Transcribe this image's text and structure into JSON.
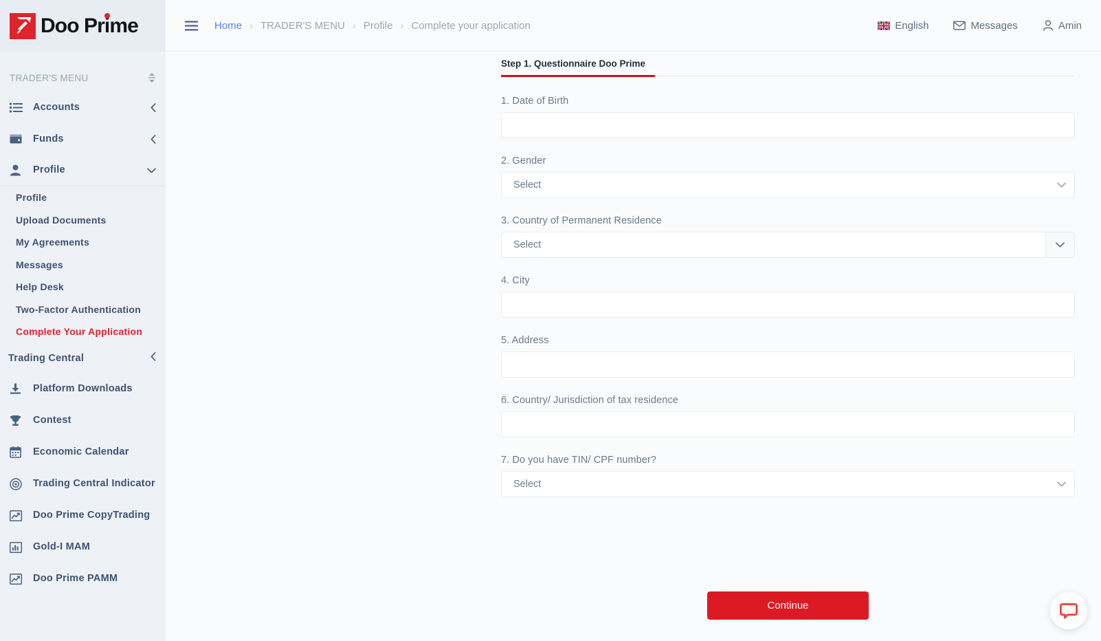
{
  "brand": {
    "name": "Doo Prime",
    "logo_icon": "doo-prime-logo",
    "primary_color": "#e0242b",
    "button_color": "#dc1a23",
    "tab_underline_color": "#c9141e"
  },
  "sidebar": {
    "section_title": "TRADER'S MENU",
    "sort_icon": "sort-updown-icon",
    "nav": [
      {
        "label": "Accounts",
        "icon": "list-icon",
        "chevron": "chevron-left-icon",
        "expanded": false
      },
      {
        "label": "Funds",
        "icon": "wallet-icon",
        "chevron": "chevron-left-icon",
        "expanded": false
      },
      {
        "label": "Profile",
        "icon": "user-icon",
        "chevron": "chevron-down-icon",
        "expanded": true
      }
    ],
    "profile_submenu": [
      {
        "label": "Profile",
        "active": false
      },
      {
        "label": "Upload Documents",
        "active": false
      },
      {
        "label": "My Agreements",
        "active": false
      },
      {
        "label": "Messages",
        "active": false
      },
      {
        "label": "Help Desk",
        "active": false
      },
      {
        "label": "Two-Factor Authentication",
        "active": false
      },
      {
        "label": "Complete Your Application",
        "active": true
      }
    ],
    "trading_central": {
      "label": "Trading Central",
      "chevron": "chevron-left-icon"
    },
    "tools": [
      {
        "label": "Platform Downloads",
        "icon": "download-icon"
      },
      {
        "label": "Contest",
        "icon": "trophy-icon"
      },
      {
        "label": "Economic Calendar",
        "icon": "calendar-icon"
      },
      {
        "label": "Trading Central Indicator",
        "icon": "target-icon"
      },
      {
        "label": "Doo Prime CopyTrading",
        "icon": "chart-line-up-icon"
      },
      {
        "label": "Gold-I MAM",
        "icon": "bar-chart-icon"
      },
      {
        "label": "Doo Prime PAMM",
        "icon": "chart-line-up-icon"
      }
    ]
  },
  "header": {
    "menu_toggle_icon": "hamburger-icon",
    "breadcrumb": [
      {
        "label": "Home",
        "link": true
      },
      {
        "label": "TRADER'S MENU",
        "link": false
      },
      {
        "label": "Profile",
        "link": false
      },
      {
        "label": "Complete your application",
        "link": false
      }
    ],
    "separator": "›",
    "language": {
      "label": "English",
      "icon": "uk-flag-icon"
    },
    "messages": {
      "label": "Messages",
      "icon": "envelope-icon"
    },
    "user": {
      "label": "Amin",
      "icon": "user-icon"
    }
  },
  "main": {
    "tabs": [
      {
        "label": "Step 1. Questionnaire Doo Prime",
        "active": true
      }
    ],
    "fields": [
      {
        "label": "1. Date of Birth",
        "type": "text",
        "value": "",
        "placeholder": ""
      },
      {
        "label": "2. Gender",
        "type": "select",
        "value": "Select",
        "chevron": "chevron-down-icon"
      },
      {
        "label": "3. Country of Permanent Residence",
        "type": "split-select",
        "value": "Select",
        "chevron": "chevron-down-icon"
      },
      {
        "label": "4. City",
        "type": "text",
        "value": "",
        "placeholder": ""
      },
      {
        "label": "5. Address",
        "type": "text",
        "value": "",
        "placeholder": ""
      },
      {
        "label": "6. Country/ Jurisdiction of tax residence",
        "type": "text",
        "value": "",
        "placeholder": ""
      },
      {
        "label": "7. Do you have TIN/ CPF number?",
        "type": "select",
        "value": "Select",
        "chevron": "chevron-down-icon"
      }
    ],
    "continue_label": "Continue"
  },
  "chat": {
    "icon": "chat-bubble-icon"
  }
}
